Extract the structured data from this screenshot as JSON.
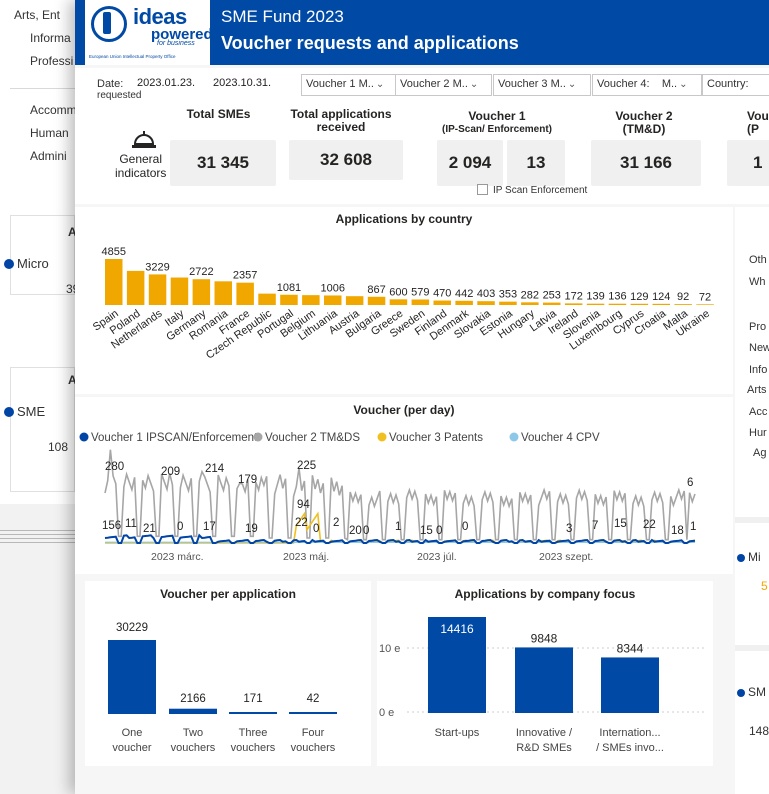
{
  "background_report": {
    "left_list_top": [
      "Arts, Ent",
      "Informa",
      "Professi"
    ],
    "left_list_bottom": [
      "Accomm",
      "Human",
      "Admini"
    ],
    "card1_title": "A",
    "card1_legend": "Micro",
    "card1_value": "39",
    "card2_title": "A",
    "card2_legend": "SME",
    "card2_value": "108",
    "right_list": [
      "Oth",
      "Wh",
      "Pro",
      "New",
      "Info",
      "Arts",
      "Acc",
      "Hur",
      "Ag"
    ],
    "right_legend1": "Mi",
    "right_value1": "5",
    "right_legend2": "SM",
    "right_value2": "148"
  },
  "header": {
    "logo_word": "ideas",
    "logo_word2": "powered",
    "logo_word3": "for business",
    "logo_office": "European Union Intellectual Property Office",
    "title_line1": "SME Fund 2023",
    "title_line2": "Voucher requests and applications"
  },
  "filters": {
    "date_label": "Date:",
    "date_sublabel": "requested",
    "date_from": "2023.01.23.",
    "date_to": "2023.10.31.",
    "voucher1": "Voucher 1  M..",
    "voucher2": "Voucher 2  M..",
    "voucher3": "Voucher 3  M..",
    "voucher4": "Voucher 4:",
    "voucher4_value": "M..",
    "country": "Country:"
  },
  "kpi": {
    "general_indicators": [
      "General",
      "indicators"
    ],
    "total_smes_label": "Total SMEs",
    "total_smes_value": "31 345",
    "total_apps_label": [
      "Total applications",
      "received"
    ],
    "total_apps_value": "32 608",
    "voucher1_label": "Voucher 1",
    "voucher1_sub": "(IP-Scan/ Enforcement)",
    "voucher1_value_a": "2 094",
    "voucher1_value_b": "13",
    "voucher2_label": [
      "Voucher 2",
      "(TM&D)"
    ],
    "voucher2_value": "31 166",
    "voucher3_label": [
      "Vou",
      "(P"
    ],
    "voucher3_value": "1",
    "checkbox_label": "IP Scan Enforcement"
  },
  "chart_country": {
    "title": "Applications by country",
    "color": "#f0a800"
  },
  "chart_daily": {
    "title": "Voucher (per day)",
    "legend": [
      {
        "name": "Voucher 1 IPSCAN/Enforcement",
        "color": "#0044a5"
      },
      {
        "name": "Voucher 2 TM&DS",
        "color": "#a6a6a6"
      },
      {
        "name": "Voucher 3 Patents",
        "color": "#f0c020"
      },
      {
        "name": "Voucher 4 CPV",
        "color": "#8ec8e8"
      }
    ],
    "x_labels": [
      "2023 márc.",
      "2023 máj.",
      "2023 júl.",
      "2023 szept."
    ],
    "annotations": [
      "280",
      "209",
      "214",
      "179",
      "225",
      "94",
      "22",
      "156",
      "11",
      "21",
      "0",
      "17",
      "19",
      "0",
      "2",
      "20",
      "0",
      "1",
      "15",
      "0",
      "0",
      "3",
      "7",
      "15",
      "22",
      "18",
      "1",
      "6"
    ]
  },
  "chart_vpa": {
    "title": "Voucher per application",
    "color": "#0049a5"
  },
  "chart_focus": {
    "title": "Applications by company focus",
    "color": "#0049a5",
    "y_ticks": [
      "10 e",
      "0 e"
    ]
  },
  "chart_data": [
    {
      "type": "bar",
      "title": "Applications by country",
      "categories": [
        "Spain",
        "Poland",
        "Netherlands",
        "Italy",
        "Germany",
        "Romania",
        "France",
        "Czech Republic",
        "Portugal",
        "Belgium",
        "Lithuania",
        "Austria",
        "Bulgaria",
        "Greece",
        "Sweden",
        "Finland",
        "Denmark",
        "Slovakia",
        "Estonia",
        "Hungary",
        "Latvia",
        "Ireland",
        "Slovenia",
        "Luxembourg",
        "Cyprus",
        "Croatia",
        "Malta",
        "Ukraine"
      ],
      "values": [
        4855,
        3229,
        null,
        2722,
        null,
        2357,
        null,
        1081,
        null,
        1006,
        null,
        867,
        600,
        579,
        470,
        442,
        403,
        353,
        282,
        253,
        172,
        139,
        136,
        129,
        124,
        92,
        72,
        null
      ],
      "bar_values": [
        4855,
        3600,
        3229,
        2900,
        2722,
        2500,
        2357,
        1200,
        1081,
        1040,
        1006,
        930,
        867,
        600,
        579,
        470,
        442,
        403,
        353,
        282,
        253,
        172,
        139,
        136,
        129,
        124,
        92,
        72
      ],
      "labels": [
        "4855",
        "",
        "3229",
        "",
        "2722",
        "",
        "2357",
        "",
        "1081",
        "",
        "1006",
        "",
        "867",
        "600",
        "579",
        "470",
        "442",
        "403",
        "353",
        "282",
        "253",
        "172",
        "139",
        "136",
        "129",
        "124",
        "92",
        "72"
      ]
    },
    {
      "type": "line",
      "title": "Voucher (per day)",
      "series": [
        {
          "name": "Voucher 1 IPSCAN/Enforcement"
        },
        {
          "name": "Voucher 2 TM&DS"
        },
        {
          "name": "Voucher 3 Patents"
        },
        {
          "name": "Voucher 4 CPV"
        }
      ]
    },
    {
      "type": "bar",
      "title": "Voucher per application",
      "categories": [
        "One voucher",
        "Two vouchers",
        "Three vouchers",
        "Four vouchers"
      ],
      "values": [
        30229,
        2166,
        171,
        42
      ]
    },
    {
      "type": "bar",
      "title": "Applications by company focus",
      "categories": [
        "Start-ups",
        "Innovative / R&D SMEs",
        "Internation... / SMEs invo..."
      ],
      "values": [
        14416,
        9848,
        8344
      ],
      "yticks": [
        "10 e",
        "0 e"
      ]
    }
  ]
}
